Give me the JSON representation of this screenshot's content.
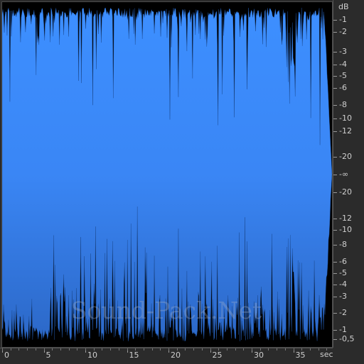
{
  "db_scale": {
    "unit": "dB",
    "upper_ticks": [
      "-1",
      "-2",
      "-3",
      "-4",
      "-5",
      "-6",
      "-8",
      "-10",
      "-12",
      "-20"
    ],
    "center_tick": "-∞",
    "lower_ticks": [
      "-20",
      "-12",
      "-10",
      "-8",
      "-6",
      "-5",
      "-4",
      "-3",
      "-2",
      "-1",
      "-0,5"
    ]
  },
  "time_scale": {
    "unit": "sec",
    "ticks": [
      "0",
      "5",
      "10",
      "15",
      "20",
      "25",
      "30",
      "35"
    ]
  },
  "watermark": "Sound-Pack.Net",
  "colors": {
    "wave_top": "#3a8bff",
    "wave_bottom": "#2f6fd0",
    "background": "#000000",
    "panel": "#2b2b2b"
  }
}
